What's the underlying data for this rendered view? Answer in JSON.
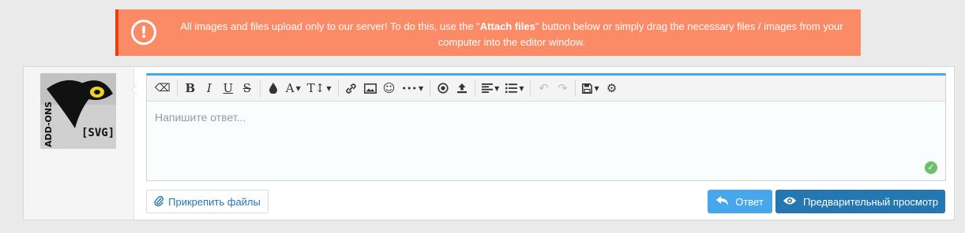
{
  "notice": {
    "icon": "exclamation-circle-icon",
    "text_before": "All images and files upload only to our server! To do this, use the \"",
    "text_bold": "Attach files",
    "text_after": "\" button below or simply drag the necessary files / images from your computer into the editor window.",
    "colors": {
      "background": "#fb8a66",
      "border": "#e8410e"
    }
  },
  "avatar": {
    "text_vertical": "ADD-ONS",
    "text_badge": "[SVG]"
  },
  "editor": {
    "placeholder": "Напишите ответ...",
    "toolbar": [
      {
        "name": "eraser-icon",
        "glyph": "⌫"
      },
      {
        "name": "bold-icon",
        "glyph": "B"
      },
      {
        "name": "italic-icon",
        "glyph": "I"
      },
      {
        "name": "underline-icon",
        "glyph": "U"
      },
      {
        "name": "strikethrough-icon",
        "glyph": "S"
      },
      {
        "name": "color-drop-icon",
        "glyph": "🌢"
      },
      {
        "name": "font-family-icon",
        "glyph": "A"
      },
      {
        "name": "font-size-icon",
        "glyph": "T↕"
      },
      {
        "name": "link-icon",
        "glyph": "🔗"
      },
      {
        "name": "image-icon",
        "glyph": "🖼"
      },
      {
        "name": "smiley-icon",
        "glyph": "☺"
      },
      {
        "name": "more-icon",
        "glyph": "•••"
      },
      {
        "name": "media-icon",
        "glyph": "◉"
      },
      {
        "name": "upload-icon",
        "glyph": "⭱"
      },
      {
        "name": "align-icon",
        "glyph": "≡"
      },
      {
        "name": "list-icon",
        "glyph": "☰"
      },
      {
        "name": "undo-icon",
        "glyph": "↶"
      },
      {
        "name": "redo-icon",
        "glyph": "↷"
      },
      {
        "name": "save-draft-icon",
        "glyph": "💾"
      },
      {
        "name": "gear-icon",
        "glyph": "⚙"
      }
    ],
    "accent": "#47a7eb"
  },
  "buttons": {
    "attach_label": "Прикрепить файлы",
    "reply_label": "Ответ",
    "preview_label": "Предварительный просмотр"
  }
}
